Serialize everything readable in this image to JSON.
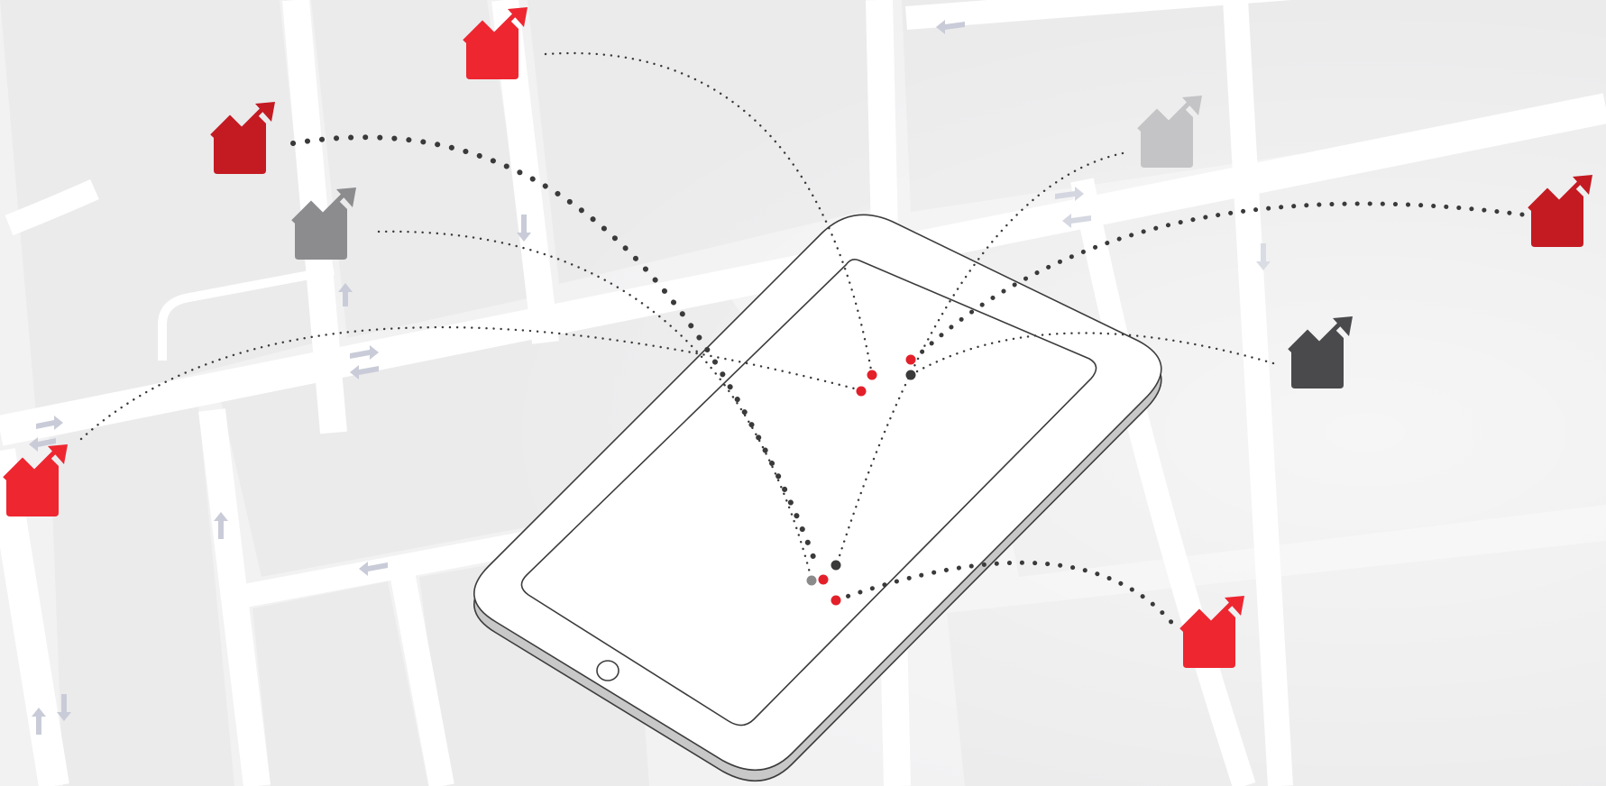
{
  "colors": {
    "background": "#f2f2f3",
    "block": "#ebebec",
    "road": "#ffffff",
    "road_arrow": "#c9ccd8",
    "tablet_body": "#ffffff",
    "tablet_shadow": "#c8c8c8",
    "tablet_outline": "#3c3c3c",
    "dotted_line": "#3a3a3a",
    "icon_red_bright": "#ee2630",
    "icon_red_dark": "#c41a22",
    "icon_gray_light": "#c4c4c6",
    "icon_gray_mid": "#8c8c8e",
    "icon_gray_dark": "#4a4a4c",
    "node_red": "#e3202a",
    "node_dark": "#3a3a3a",
    "node_gray": "#8a8a8a"
  },
  "icons": [
    {
      "name": "trend-up-icon",
      "variant": "red_bright"
    },
    {
      "name": "trend-up-icon",
      "variant": "red_dark"
    },
    {
      "name": "trend-up-icon",
      "variant": "gray_mid"
    },
    {
      "name": "trend-up-icon",
      "variant": "red_bright"
    },
    {
      "name": "trend-up-icon",
      "variant": "gray_light"
    },
    {
      "name": "trend-up-icon",
      "variant": "red_dark"
    },
    {
      "name": "trend-up-icon",
      "variant": "gray_dark"
    },
    {
      "name": "trend-up-icon",
      "variant": "red_bright"
    }
  ]
}
